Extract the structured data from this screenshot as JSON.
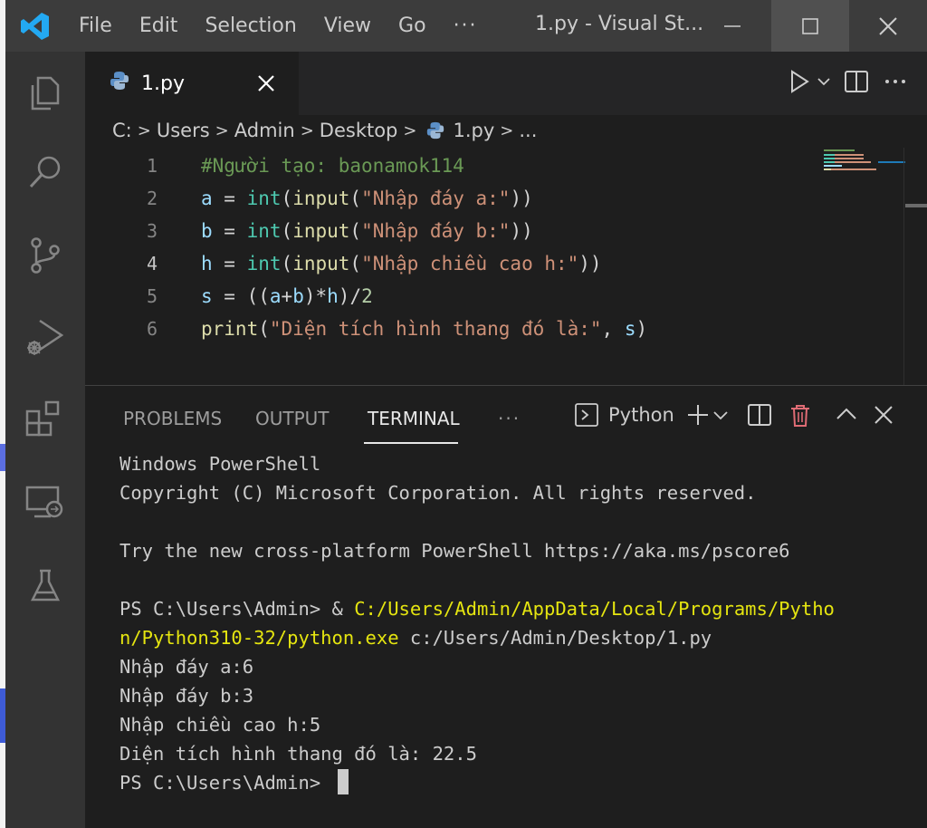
{
  "titlebar": {
    "menu": [
      "File",
      "Edit",
      "Selection",
      "View",
      "Go"
    ],
    "more": "···",
    "window_title": "1.py - Visual St..."
  },
  "editor": {
    "tab_label": "1.py",
    "breadcrumbs": [
      "C:",
      "Users",
      "Admin",
      "Desktop",
      "1.py",
      "..."
    ],
    "line_numbers": [
      "1",
      "2",
      "3",
      "4",
      "5",
      "6"
    ],
    "code": {
      "l1_comment": "#Người tạo: baonamok114",
      "l2_var": "a",
      "l2_eq": " = ",
      "l2_int": "int",
      "l2_p1": "(",
      "l2_input": "input",
      "l2_p2": "(",
      "l2_str": "\"Nhập đáy a:\"",
      "l2_p3": "))",
      "l3_var": "b",
      "l3_eq": " = ",
      "l3_int": "int",
      "l3_p1": "(",
      "l3_input": "input",
      "l3_p2": "(",
      "l3_str": "\"Nhập đáy b:\"",
      "l3_p3": "))",
      "l4_var": "h",
      "l4_eq": " = ",
      "l4_int": "int",
      "l4_p1": "(",
      "l4_input": "input",
      "l4_p2": "(",
      "l4_str": "\"Nhập chiều cao h:\"",
      "l4_p3": "))",
      "l5_var": "s",
      "l5_eq": " = ((",
      "l5_a": "a",
      "l5_plus": "+",
      "l5_b": "b",
      "l5_mid": ")*",
      "l5_h": "h",
      "l5_end": ")/",
      "l5_num": "2",
      "l6_print": "print",
      "l6_p1": "(",
      "l6_str": "\"Diện tích hình thang đó là:\"",
      "l6_comma": ", ",
      "l6_s": "s",
      "l6_p2": ")"
    }
  },
  "panel": {
    "tabs": [
      "PROBLEMS",
      "OUTPUT",
      "TERMINAL"
    ],
    "active_tab": "TERMINAL",
    "more": "···",
    "terminal_name": "Python",
    "terminal": {
      "l1": "Windows PowerShell",
      "l2": "Copyright (C) Microsoft Corporation. All rights reserved.",
      "l3": "",
      "l4": "Try the new cross-platform PowerShell https://aka.ms/pscore6",
      "l5": "",
      "l6_prompt": "PS C:\\Users\\Admin> & ",
      "l6_path": "C:/Users/Admin/AppData/Local/Programs/Pytho",
      "l7_path": "n/Python310-32/python.exe",
      "l7_rest": " c:/Users/Admin/Desktop/1.py",
      "l8": "Nhập đáy a:6",
      "l9": "Nhập đáy b:3",
      "l10": "Nhập chiều cao h:5",
      "l11": "Diện tích hình thang đó là: 22.5",
      "l12": "PS C:\\Users\\Admin> "
    }
  },
  "colors": {
    "accent": "#007acc",
    "titlebar": "#3c3c3c",
    "activitybar": "#333333",
    "editor_bg": "#1e1e1e",
    "comment": "#6a9955",
    "string": "#ce9178",
    "function": "#dcdcaa",
    "class": "#4ec9b0",
    "terminal_yellow": "#e5e510"
  },
  "icons": [
    "vscode-logo-icon",
    "explorer-icon",
    "search-icon",
    "source-control-icon",
    "run-debug-icon",
    "extensions-icon",
    "remote-explorer-icon",
    "testing-icon",
    "python-file-icon",
    "close-icon",
    "run-icon",
    "split-editor-icon",
    "trash-icon",
    "chevron-up-icon",
    "chevron-down-icon",
    "plus-icon",
    "terminal-icon"
  ]
}
